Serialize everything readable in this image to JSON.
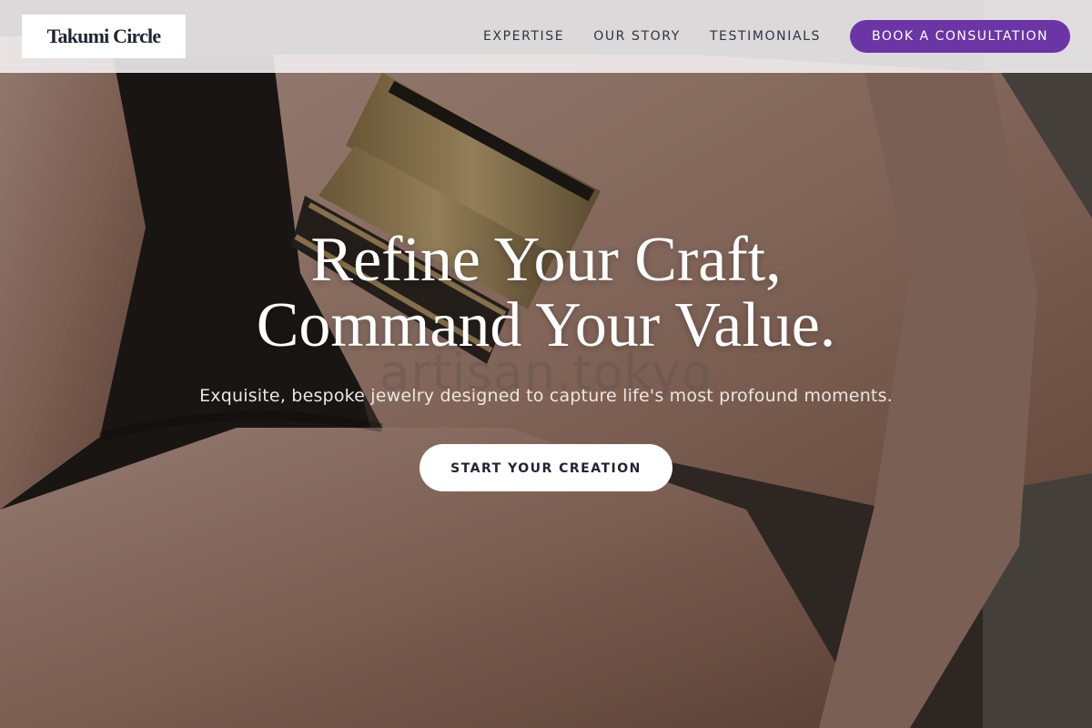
{
  "brand": {
    "logo_text": "Takumi Circle"
  },
  "nav": {
    "links": [
      {
        "label": "EXPERTISE"
      },
      {
        "label": "OUR STORY"
      },
      {
        "label": "TESTIMONIALS"
      }
    ],
    "cta_label": "BOOK A CONSULTATION"
  },
  "hero": {
    "headline_line1": "Refine Your Craft,",
    "headline_line2": "Command Your Value.",
    "subheadline": "Exquisite, bespoke jewelry designed to capture life's most profound moments.",
    "cta_label": "START YOUR CREATION",
    "watermark": "artisan.tokyo"
  },
  "colors": {
    "accent": "#6b35a6",
    "nav_background": "#f4f2f2",
    "text_dark": "#1f2433",
    "headline": "#ffffff"
  },
  "icons": []
}
